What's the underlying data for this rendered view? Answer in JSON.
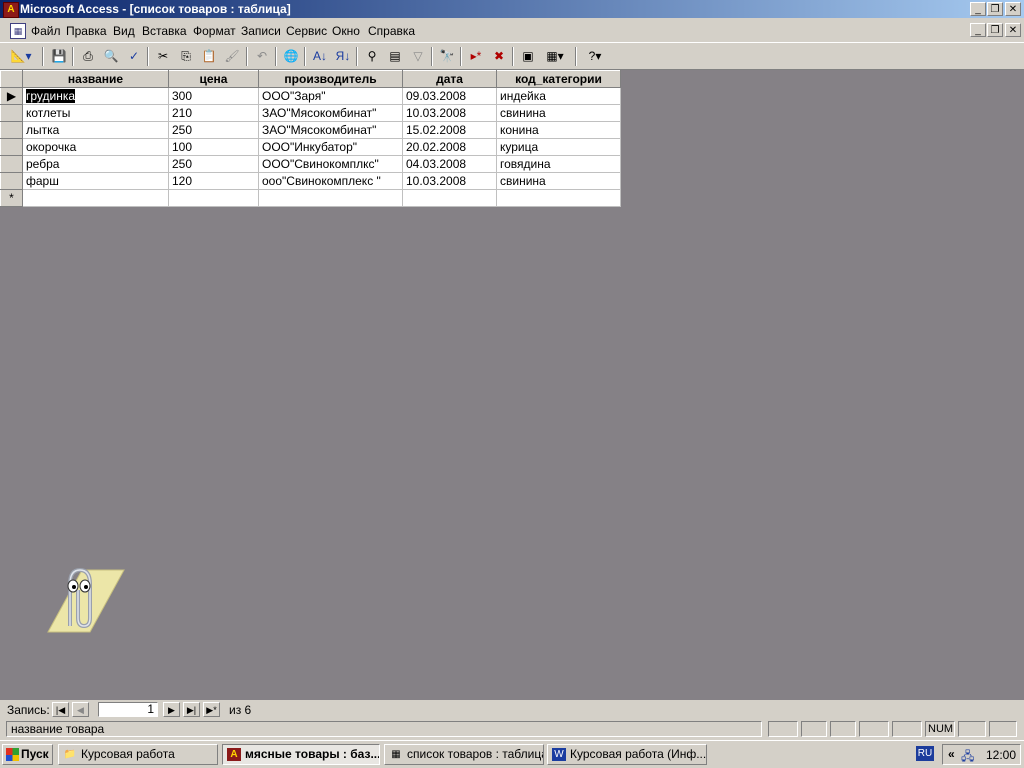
{
  "window": {
    "title": "Microsoft Access - [список товаров : таблица]"
  },
  "menu": [
    "Файл",
    "Правка",
    "Вид",
    "Вставка",
    "Формат",
    "Записи",
    "Сервис",
    "Окно",
    "Справка"
  ],
  "table": {
    "columns": [
      "название",
      "цена",
      "производитель",
      "дата",
      "код_категории"
    ],
    "rows": [
      [
        "грудинка",
        "300",
        "ООО\"Заря\"",
        "09.03.2008",
        "индейка"
      ],
      [
        "котлеты",
        "210",
        "ЗАО\"Мясокомбинат\"",
        "10.03.2008",
        "свинина"
      ],
      [
        "лытка",
        "250",
        "ЗАО\"Мясокомбинат\"",
        "15.02.2008",
        "конина"
      ],
      [
        "окорочка",
        "100",
        "ООО\"Инкубатор\"",
        "20.02.2008",
        "курица"
      ],
      [
        "ребра",
        "250",
        "ООО\"Свинокомплкс\"",
        "04.03.2008",
        "говядина"
      ],
      [
        "фарш",
        "120",
        "ооо\"Свинокомплекс \"",
        "10.03.2008",
        "свинина"
      ]
    ],
    "new_row_marker": "*",
    "current_row_marker": "▶"
  },
  "navigation": {
    "label": "Запись:",
    "current": "1",
    "of_text": "из  6"
  },
  "status": {
    "message": "название товара",
    "num": "NUM"
  },
  "taskbar": {
    "start": "Пуск",
    "tasks": [
      "Курсовая работа",
      "мясные товары : баз...",
      "список товаров : таблица",
      "Курсовая работа (Инф..."
    ],
    "lang": "RU",
    "clock": "12:00"
  },
  "icons": {
    "design_view": "design-view-icon",
    "save": "save-icon",
    "print": "print-icon",
    "preview": "print-preview-icon",
    "spelling": "spelling-icon",
    "cut": "cut-icon",
    "copy": "copy-icon",
    "paste": "paste-icon",
    "format_painter": "format-painter-icon",
    "undo": "undo-icon",
    "hyperlink": "hyperlink-icon",
    "sort_asc": "sort-ascending-icon",
    "sort_desc": "sort-descending-icon",
    "filter_selection": "filter-by-selection-icon",
    "filter_form": "filter-by-form-icon",
    "apply_filter": "apply-filter-icon",
    "find": "find-icon",
    "new_record": "new-record-icon",
    "delete_record": "delete-record-icon",
    "database_window": "database-window-icon",
    "new_object": "new-object-icon",
    "help": "help-icon"
  }
}
